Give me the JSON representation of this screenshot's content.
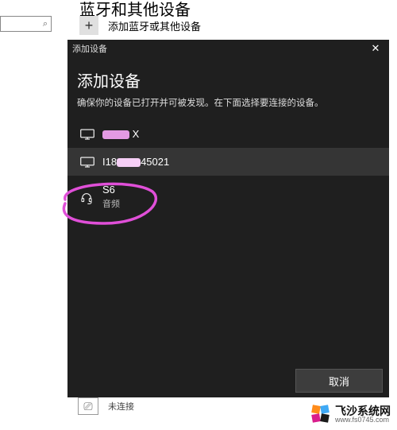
{
  "page": {
    "title": "蓝牙和其他设备",
    "add_button_label": "添加蓝牙或其他设备",
    "search_glyph": "⌕"
  },
  "behind": {
    "status": "未连接",
    "bt_glyph": "⎚"
  },
  "dialog": {
    "titlebar": "添加设备",
    "heading": "添加设备",
    "subtext": "确保你的设备已打开并可被发现。在下面选择要连接的设备。",
    "close_glyph": "✕",
    "devices": [
      {
        "name_suffix": " X",
        "subtitle": ""
      },
      {
        "name_prefix": "I18",
        "name_suffix": "45021",
        "subtitle": ""
      },
      {
        "name": "S6",
        "subtitle": "音频"
      }
    ],
    "cancel_label": "取消"
  },
  "watermark": {
    "main": "飞沙系统网",
    "sub": "www.fs0745.com"
  }
}
